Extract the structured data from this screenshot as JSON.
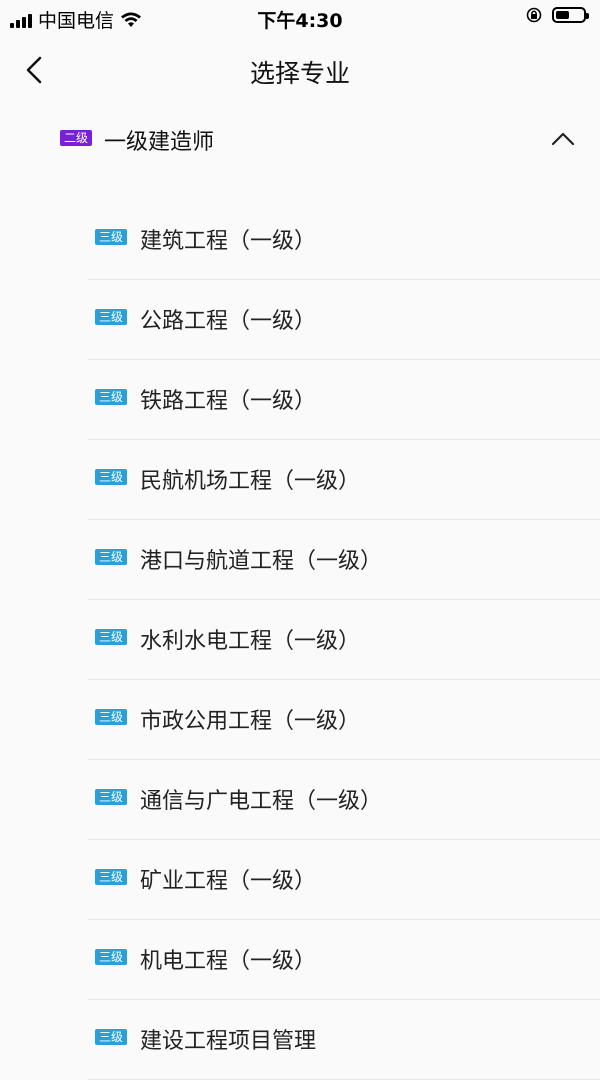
{
  "status_bar": {
    "carrier": "中国电信",
    "time": "下午4:30"
  },
  "nav": {
    "title": "选择专业",
    "back_icon": "chevron-left-icon"
  },
  "group": {
    "badge": "二级",
    "badge_color": "#7a1fd8",
    "label": "一级建造师",
    "expanded": true,
    "toggle_icon": "chevron-up-icon"
  },
  "sub_badge_color": "#2a9fd8",
  "items": [
    {
      "badge": "三级",
      "label": "建筑工程（一级）"
    },
    {
      "badge": "三级",
      "label": "公路工程（一级）"
    },
    {
      "badge": "三级",
      "label": "铁路工程（一级）"
    },
    {
      "badge": "三级",
      "label": "民航机场工程（一级）"
    },
    {
      "badge": "三级",
      "label": "港口与航道工程（一级）"
    },
    {
      "badge": "三级",
      "label": "水利水电工程（一级）"
    },
    {
      "badge": "三级",
      "label": "市政公用工程（一级）"
    },
    {
      "badge": "三级",
      "label": "通信与广电工程（一级）"
    },
    {
      "badge": "三级",
      "label": "矿业工程（一级）"
    },
    {
      "badge": "三级",
      "label": "机电工程（一级）"
    },
    {
      "badge": "三级",
      "label": "建设工程项目管理"
    }
  ]
}
